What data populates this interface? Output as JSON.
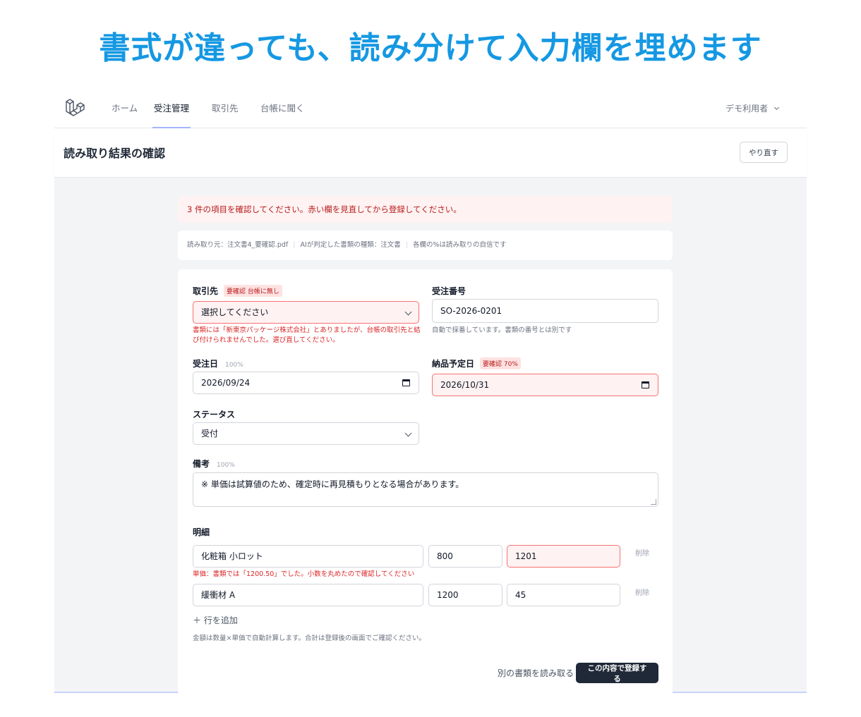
{
  "headline": "書式が違っても、読み分けて入力欄を埋めます",
  "nav": {
    "items": [
      "ホーム",
      "受注管理",
      "取引先",
      "台帳に聞く"
    ],
    "active_index": 1,
    "user": "デモ利用者"
  },
  "page": {
    "title": "読み取り結果の確認",
    "redo_label": "やり直す"
  },
  "alert": "3 件の項目を確認してください。赤い欄を見直してから登録してください。",
  "meta": {
    "source": "読み取り元：注文書4_要確認.pdf",
    "doc_type": "AIが判定した書類の種類：注文書",
    "confidence_note": "各欄の%は読み取りの自信です"
  },
  "form": {
    "partner": {
      "label": "取引先",
      "badge": "要確認 台帳に無し",
      "value": "選択してください",
      "error": "書類には「新東京パッケージ株式会社」とありましたが、台帳の取引先と結び付けられませんでした。選び直してください。"
    },
    "order_no": {
      "label": "受注番号",
      "value": "SO-2026-0201",
      "help": "自動で採番しています。書類の番号とは別です"
    },
    "order_date": {
      "label": "受注日",
      "confidence": "100%",
      "value": "2026/09/24"
    },
    "delivery_date": {
      "label": "納品予定日",
      "badge": "要確認 70%",
      "value": "2026/10/31"
    },
    "status": {
      "label": "ステータス",
      "value": "受付"
    },
    "remarks": {
      "label": "備考",
      "confidence": "100%",
      "value": "※ 単価は試算値のため、確定時に再見積もりとなる場合があります。"
    },
    "lines": {
      "label": "明細",
      "rows": [
        {
          "name": "化粧箱 小ロット",
          "qty": "800",
          "price": "1201",
          "price_error": "単価：書類では「1200.50」でした。小数を丸めたので確認してください",
          "delete_label": "削除"
        },
        {
          "name": "緩衝材 A",
          "qty": "1200",
          "price": "45",
          "delete_label": "削除"
        }
      ],
      "add_label": "＋ 行を追加",
      "note": "金額は数量×単価で自動計算します。合計は登録後の画面でご確認ください。"
    },
    "actions": {
      "secondary": "別の書類を読み取る",
      "primary": "この内容で登録する"
    }
  },
  "colors": {
    "headline": "#1598e3",
    "error": "#dc2626",
    "error_bg": "#fef2f2",
    "primary_button": "#1f2937"
  }
}
